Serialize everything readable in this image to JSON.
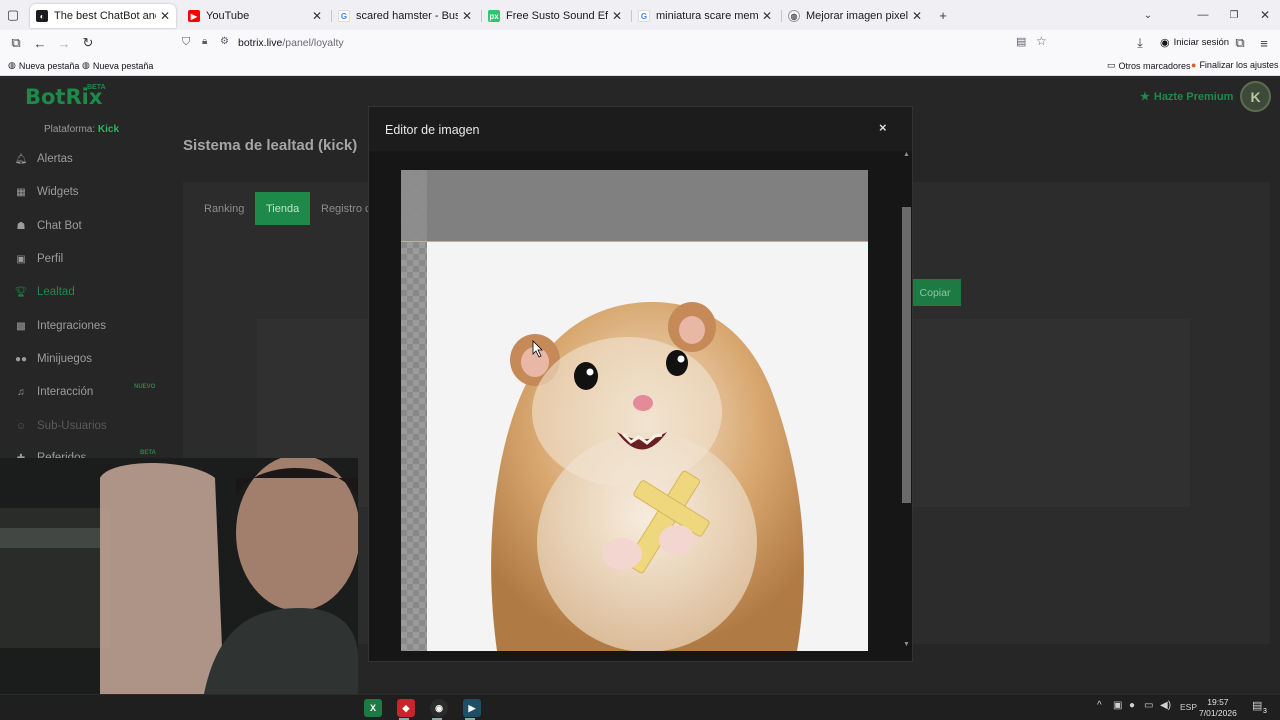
{
  "browser": {
    "tabs": [
      {
        "title": "The best ChatBot and Widgets f",
        "icon": "botrix-favicon-icon",
        "color": "#1b1b1f",
        "active": true
      },
      {
        "title": "YouTube",
        "icon": "youtube-icon",
        "color": "#ff0000",
        "active": false
      },
      {
        "title": "scared hamster - Buscar con Go",
        "icon": "google-icon",
        "color": "#4285f4",
        "active": false
      },
      {
        "title": "Free Susto Sound Effects Downl",
        "icon": "pixabay-icon",
        "color": "#2ec66d",
        "active": false
      },
      {
        "title": "miniatura scare meme - Buscar",
        "icon": "google-icon",
        "color": "#4285f4",
        "active": false
      },
      {
        "title": "Mejorar imagen pixelada",
        "icon": "globe-icon",
        "color": "#555555",
        "active": false
      }
    ],
    "new_tab": "+",
    "url_host": "botrix.live",
    "url_path": "/panel/loyalty",
    "sign_in": "Iniciar sesión",
    "bookmarks": [
      "Nueva pestaña",
      "Nueva pestaña"
    ],
    "other_bookmarks": "Otros marcadores",
    "finish_settings": "Finalizar los ajustes"
  },
  "app": {
    "logo": "BotRix",
    "beta": "BETA",
    "platform_label": "Plataforma:",
    "platform_value": "Kick",
    "premium": "Hazte Premium",
    "avatar_initial": "K",
    "page_title": "Sistema de lealtad (kick)",
    "nav": [
      {
        "label": "Alertas",
        "icon": "bell-icon"
      },
      {
        "label": "Widgets",
        "icon": "grid-icon"
      },
      {
        "label": "Chat Bot",
        "icon": "robot-icon"
      },
      {
        "label": "Perfil",
        "icon": "id-card-icon"
      },
      {
        "label": "Lealtad",
        "icon": "trophy-icon"
      },
      {
        "label": "Integraciones",
        "icon": "puzzle-icon"
      },
      {
        "label": "Minijuegos",
        "icon": "gamepad-icon"
      },
      {
        "label": "Interacción",
        "icon": "music-icon"
      },
      {
        "label": "Sub-Usuarios",
        "icon": "users-icon"
      },
      {
        "label": "Referidos",
        "icon": "gift-icon"
      }
    ],
    "nuevo_badge": "NUEVO",
    "referidos_badge": "BETA",
    "tabs": [
      "Ranking",
      "Tienda",
      "Registro c"
    ],
    "copy_button": "Copiar"
  },
  "modal": {
    "title": "Editor de imagen",
    "close": "×",
    "image_subject": "scared hamster holding a golden cross"
  },
  "taskbar": {
    "apps": [
      {
        "name": "excel-icon",
        "color": "#1d7a45",
        "glyph": "X"
      },
      {
        "name": "recorder-icon",
        "color": "#c8242b",
        "glyph": "◆"
      },
      {
        "name": "obs-icon",
        "color": "#2b2b2b",
        "glyph": "◉"
      },
      {
        "name": "terminal-icon",
        "color": "#1f4f66",
        "glyph": "▶"
      }
    ],
    "language": "ESP",
    "time": "19:57",
    "date": "7/01/2026",
    "notifications": "3"
  }
}
